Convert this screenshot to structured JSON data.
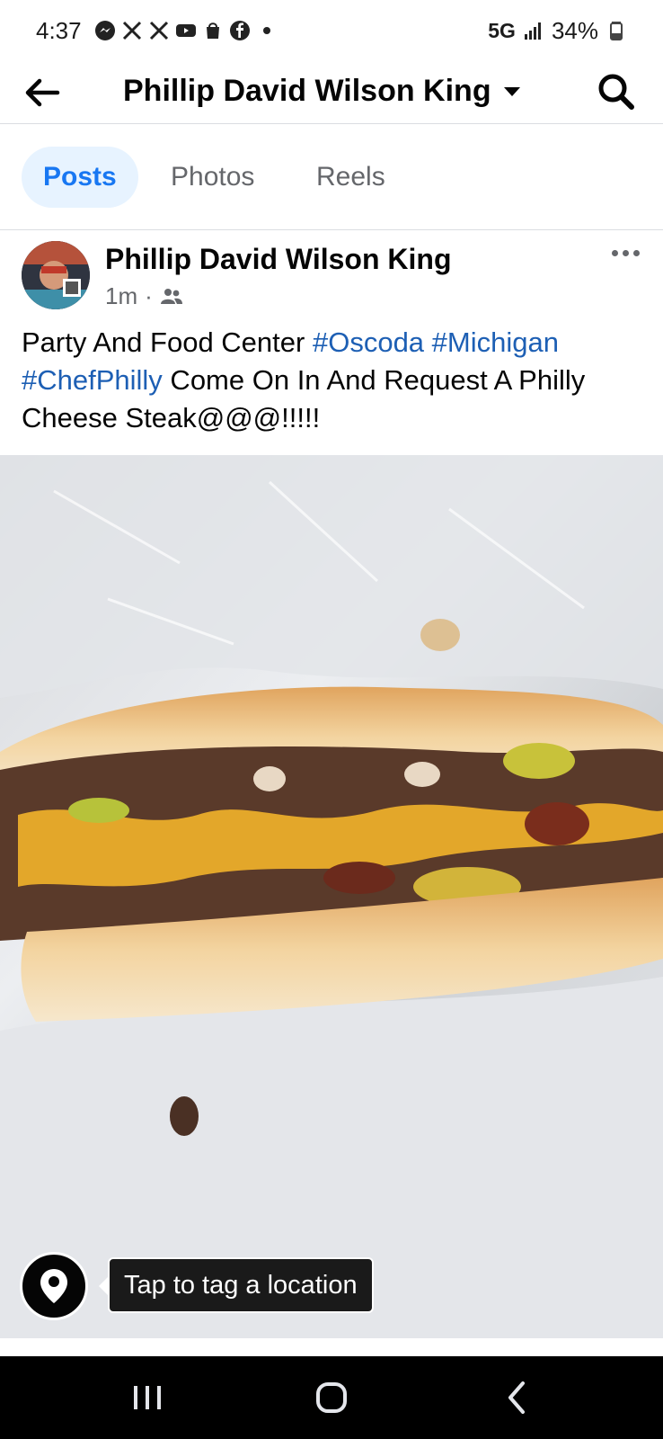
{
  "status_bar": {
    "time": "4:37",
    "network": "5G",
    "battery": "34%",
    "notification_icons": [
      "messenger-icon",
      "x-icon",
      "x-icon",
      "youtube-icon",
      "shopping-bag-icon",
      "facebook-icon",
      "dot-icon"
    ]
  },
  "header": {
    "title": "Phillip David Wilson King"
  },
  "tabs": [
    {
      "label": "Posts",
      "active": true
    },
    {
      "label": "Photos",
      "active": false
    },
    {
      "label": "Reels",
      "active": false
    }
  ],
  "post": {
    "author": "Phillip David Wilson King",
    "time": "1m",
    "separator": "·",
    "audience_icon": "friends-icon",
    "text_parts": {
      "t1": "Party And Food Center ",
      "h1": "#Oscoda",
      "t2": " ",
      "h2": "#Michigan",
      "t3": " ",
      "h3": "#ChefPhilly",
      "t4": " Come On In And Request A Philly Cheese Steak@@@!!!!!"
    }
  },
  "photo": {
    "location_tooltip": "Tap to tag a location"
  },
  "colors": {
    "accent": "#1877f2",
    "hashtag": "#1d5fb4",
    "active_tab_bg": "#e7f3ff",
    "secondary_text": "#65676b"
  }
}
